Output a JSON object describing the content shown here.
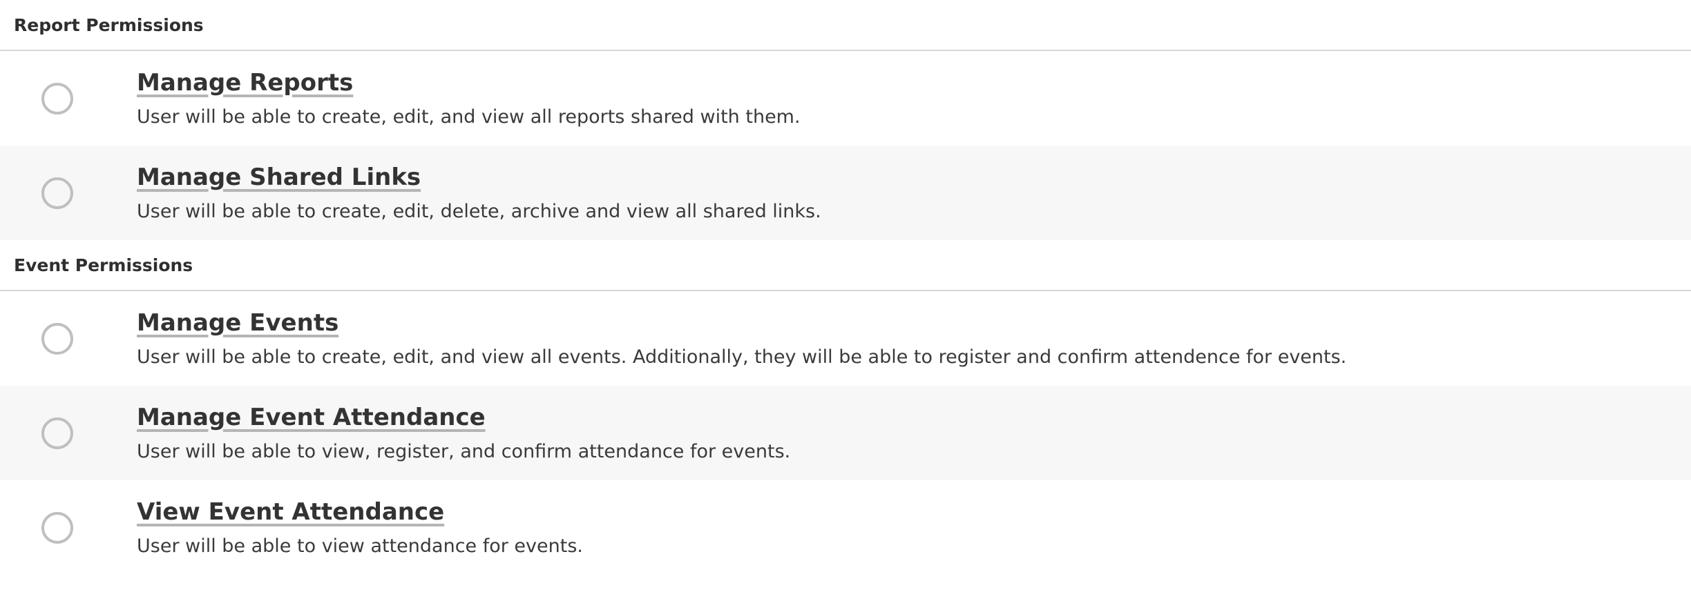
{
  "sections": [
    {
      "title": "Report Permissions",
      "items": [
        {
          "title": "Manage Reports",
          "description": "User will be able to create, edit, and view all reports shared with them."
        },
        {
          "title": "Manage Shared Links",
          "description": "User will be able to create, edit, delete, archive and view all shared links."
        }
      ]
    },
    {
      "title": "Event Permissions",
      "items": [
        {
          "title": "Manage Events",
          "description": "User will be able to create, edit, and view all events. Additionally, they will be able to register and confirm attendence for events."
        },
        {
          "title": "Manage Event Attendance",
          "description": "User will be able to view, register, and confirm attendance for events."
        },
        {
          "title": "View Event Attendance",
          "description": "User will be able to view attendance for events."
        }
      ]
    }
  ],
  "colors": {
    "row_shade": "#f7f7f7",
    "divider": "#d6d6d6",
    "radio_border": "#bfbfbf",
    "text": "#333333"
  }
}
